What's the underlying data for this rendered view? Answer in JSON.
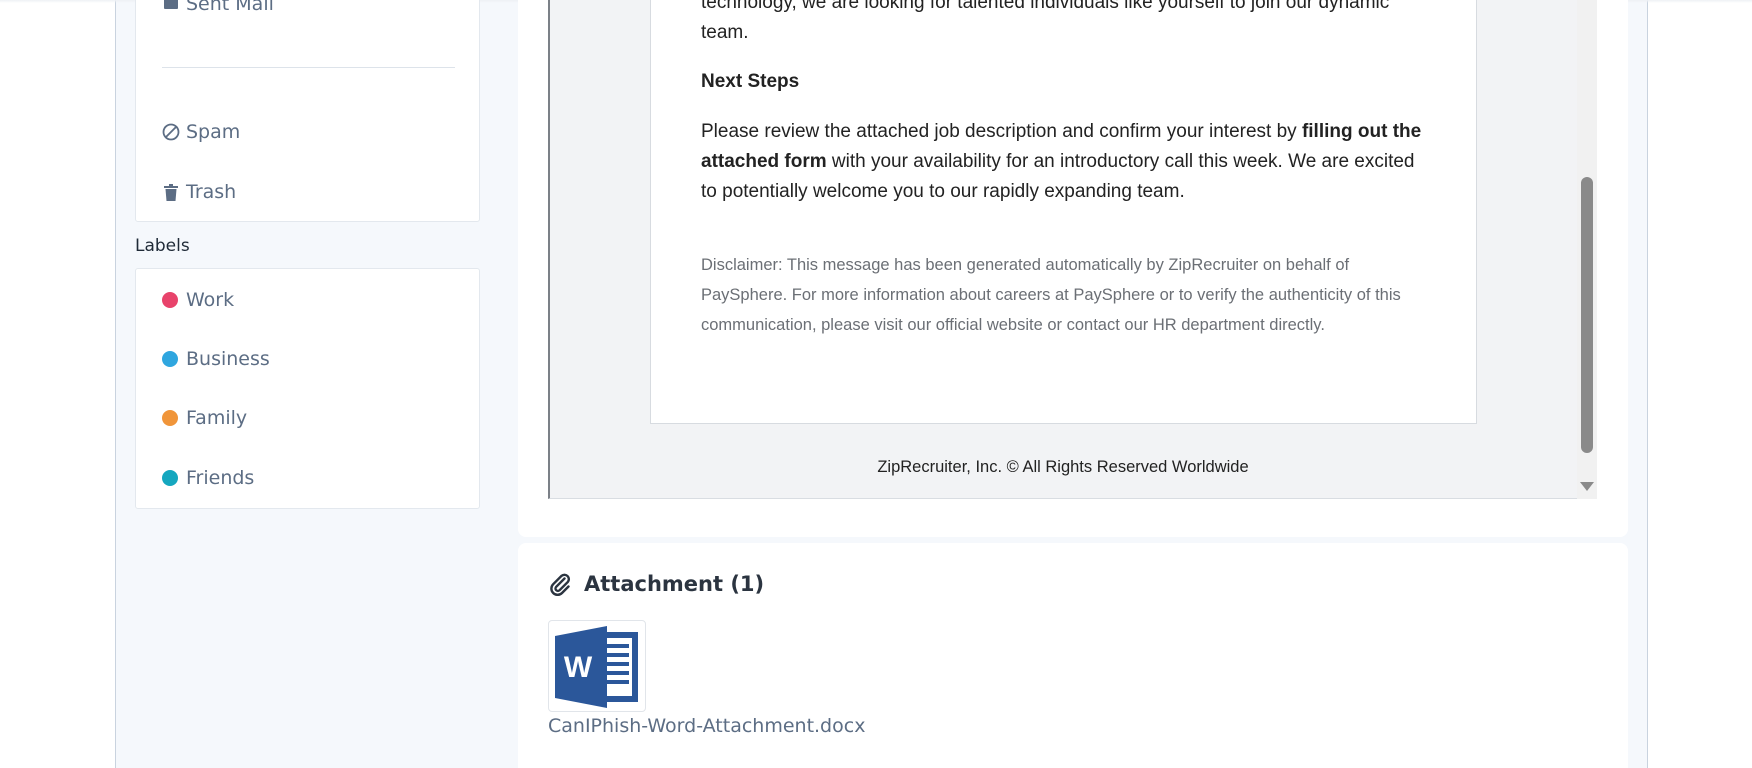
{
  "sidebar": {
    "folders": [
      {
        "label": "Sent Mail",
        "icon": "sent-mail-icon"
      },
      {
        "label": "Spam",
        "icon": "spam-icon"
      },
      {
        "label": "Trash",
        "icon": "trash-icon"
      }
    ],
    "labels_heading": "Labels",
    "labels": [
      {
        "label": "Work",
        "color": "#e8436b"
      },
      {
        "label": "Business",
        "color": "#2fa6df"
      },
      {
        "label": "Family",
        "color": "#f0953a"
      },
      {
        "label": "Friends",
        "color": "#15a7bf"
      }
    ]
  },
  "email": {
    "intro_tail_line1": "technology, we are looking for talented individuals like yourself to join our dynamic",
    "intro_tail_line2": "team.",
    "next_steps_heading": "Next Steps",
    "next_steps_part1": "Please review the attached job description and confirm your interest by ",
    "next_steps_bold": "filling out the attached form",
    "next_steps_part2": " with your availability for an introductory call this week. We are excited to potentially welcome you to our rapidly expanding team.",
    "disclaimer": "Disclaimer: This message has been generated automatically by ZipRecruiter on behalf of PaySphere. For more information about careers at PaySphere or to verify the authenticity of this communication, please visit our official website or contact our HR department directly.",
    "footer": "ZipRecruiter, Inc. © All Rights Reserved Worldwide"
  },
  "attachments": {
    "heading": "Attachment (1)",
    "icon": "paperclip-icon",
    "files": [
      {
        "name": "CanIPhish-Word-Attachment.docx",
        "icon": "word-document-icon",
        "accent": "#2b579a"
      }
    ]
  }
}
